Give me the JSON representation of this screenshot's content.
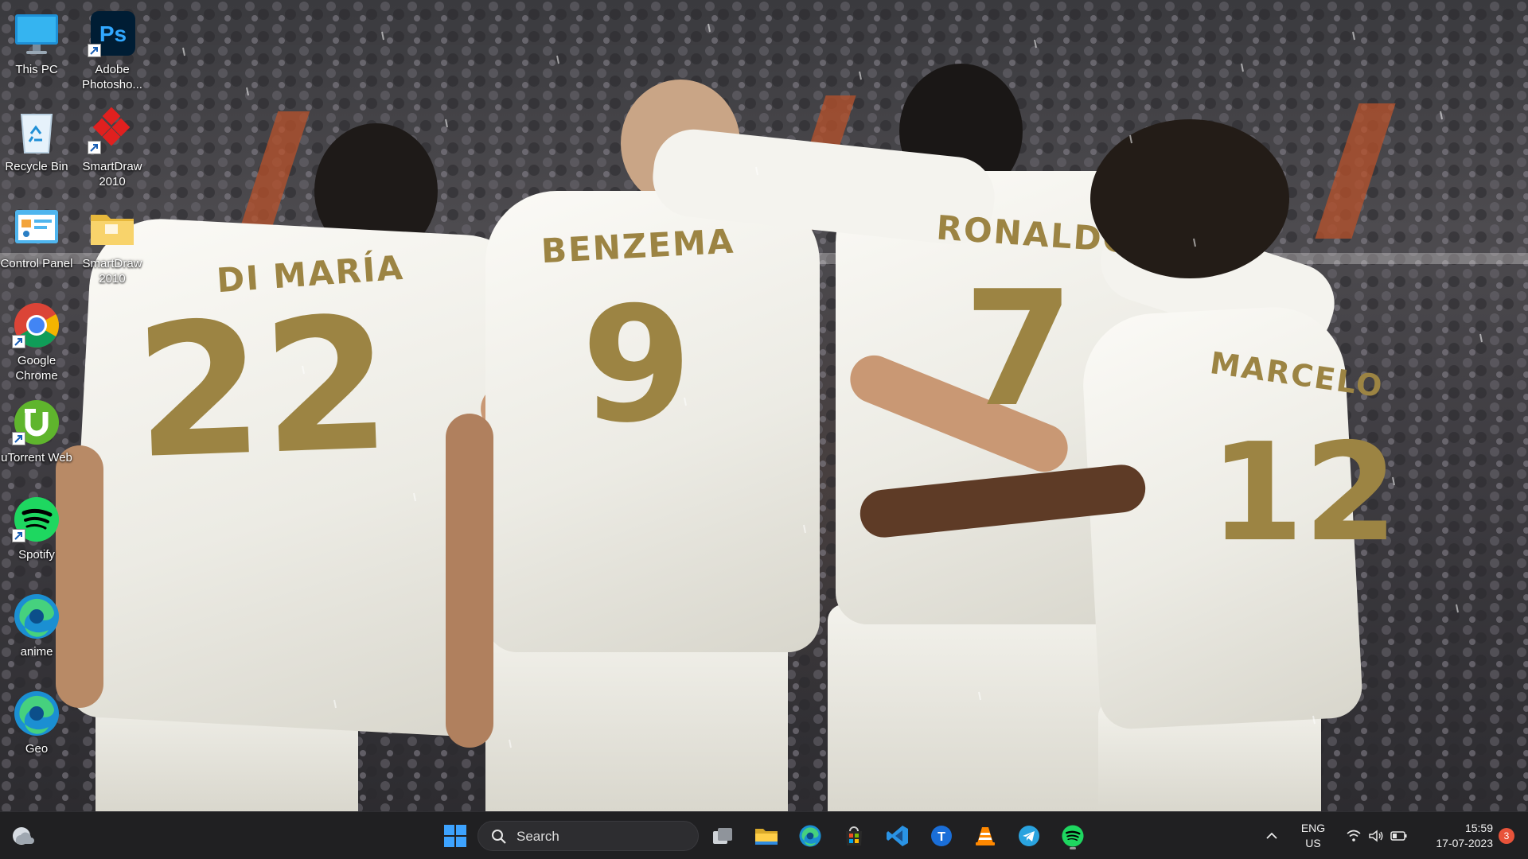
{
  "desktop": {
    "wallpaper": {
      "jersey_names": [
        "DI MARÍA",
        "BENZEMA",
        "RONALDO",
        "MARCELO"
      ],
      "jersey_numbers": [
        "22",
        "9",
        "7",
        "12"
      ],
      "jersey_color": "#f4f3ee",
      "print_color": "#9c8443"
    },
    "icons": [
      {
        "label": "This PC",
        "icon": "monitor-icon",
        "shortcut": false
      },
      {
        "label": "Adobe Photosho...",
        "icon": "photoshop-icon",
        "shortcut": true
      },
      {
        "label": "Recycle Bin",
        "icon": "recycle-bin-icon",
        "shortcut": false
      },
      {
        "label": "SmartDraw 2010",
        "icon": "smartdraw-icon",
        "shortcut": true
      },
      {
        "label": "Control Panel",
        "icon": "control-panel-icon",
        "shortcut": false
      },
      {
        "label": "SmartDraw 2010",
        "icon": "folder-icon",
        "shortcut": false
      },
      {
        "label": "Google Chrome",
        "icon": "chrome-icon",
        "shortcut": true
      },
      {
        "label": "uTorrent Web",
        "icon": "utorrent-icon",
        "shortcut": true
      },
      {
        "label": "Spotify",
        "icon": "spotify-icon",
        "shortcut": true
      },
      {
        "label": "anime",
        "icon": "edge-icon",
        "shortcut": false
      },
      {
        "label": "Geo",
        "icon": "edge-icon",
        "shortcut": false
      }
    ]
  },
  "taskbar": {
    "widgets_icon": "weather-cloud-icon",
    "start_icon": "windows-start-icon",
    "search": {
      "placeholder": "Search"
    },
    "pinned": [
      {
        "name": "task-view",
        "icon": "task-view-icon"
      },
      {
        "name": "file-explorer",
        "icon": "file-explorer-icon"
      },
      {
        "name": "edge",
        "icon": "edge-icon"
      },
      {
        "name": "microsoft-store",
        "icon": "store-icon"
      },
      {
        "name": "vscode",
        "icon": "vscode-icon"
      },
      {
        "name": "t-app",
        "icon": "t-circle-icon"
      },
      {
        "name": "vlc",
        "icon": "vlc-cone-icon"
      },
      {
        "name": "telegram",
        "icon": "telegram-icon"
      },
      {
        "name": "spotify",
        "icon": "spotify-icon"
      }
    ],
    "tray": {
      "overflow_icon": "chevron-up-icon",
      "language": {
        "line1": "ENG",
        "line2": "US"
      },
      "status_icons": [
        "wifi-icon",
        "volume-icon",
        "battery-icon"
      ],
      "time": "15:59",
      "date": "17-07-2023",
      "notification_count": "3"
    },
    "colors": {
      "background": "#202022",
      "accent": "#0f6cbd",
      "badge": "#e8533a"
    }
  }
}
